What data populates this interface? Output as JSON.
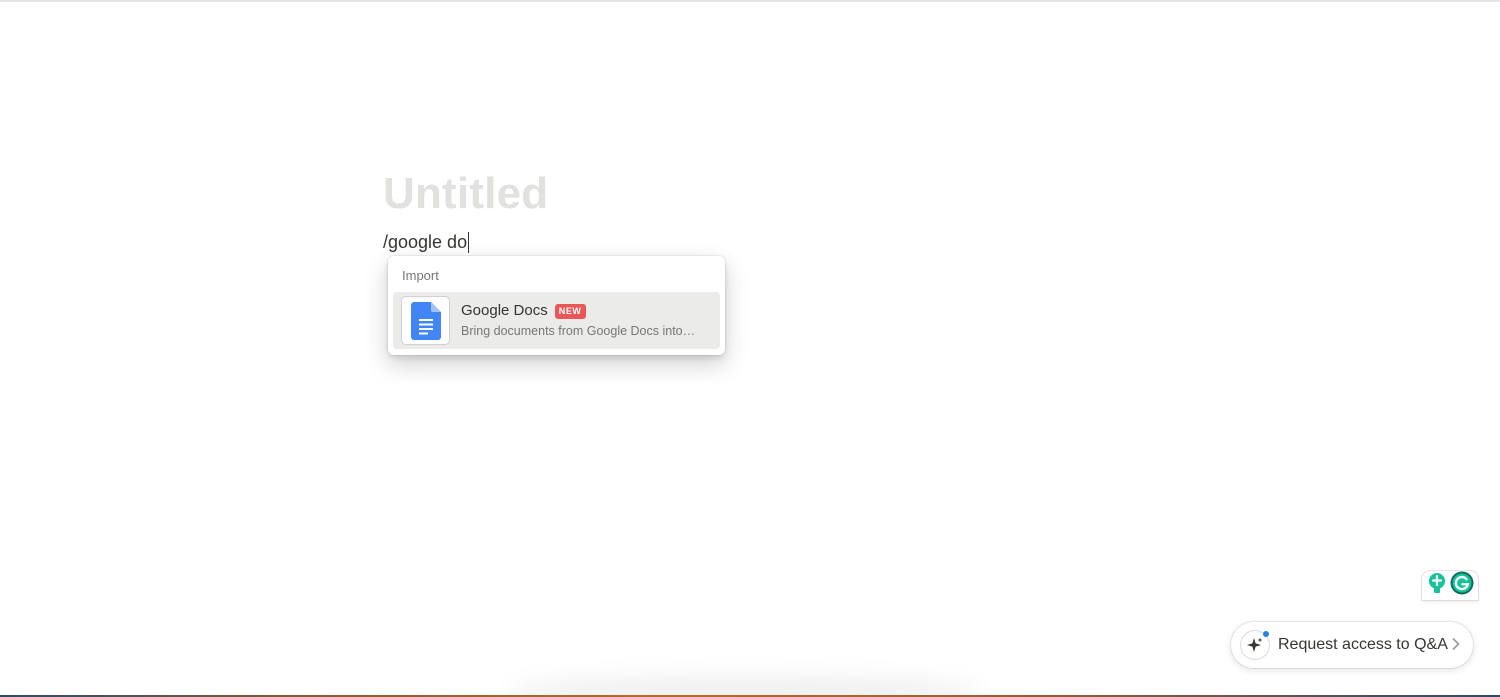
{
  "page": {
    "title_placeholder": "Untitled",
    "editor_text": "/google do"
  },
  "slash_menu": {
    "section_label": "Import",
    "items": [
      {
        "title": "Google Docs",
        "badge": "NEW",
        "description": "Bring documents from Google Docs into…",
        "icon": "google-docs-icon"
      }
    ]
  },
  "widgets": {
    "grammarly": {
      "icons": [
        "grammarly-insight-icon",
        "grammarly-logo-icon"
      ]
    },
    "qa": {
      "label": "Request access to Q&A",
      "icon": "ai-sparkle-icon"
    }
  },
  "colors": {
    "badge_red": "#eb5757",
    "docs_blue": "#4285f4",
    "grammarly_green": "#15c39a",
    "accent_blue": "#2383e2"
  }
}
